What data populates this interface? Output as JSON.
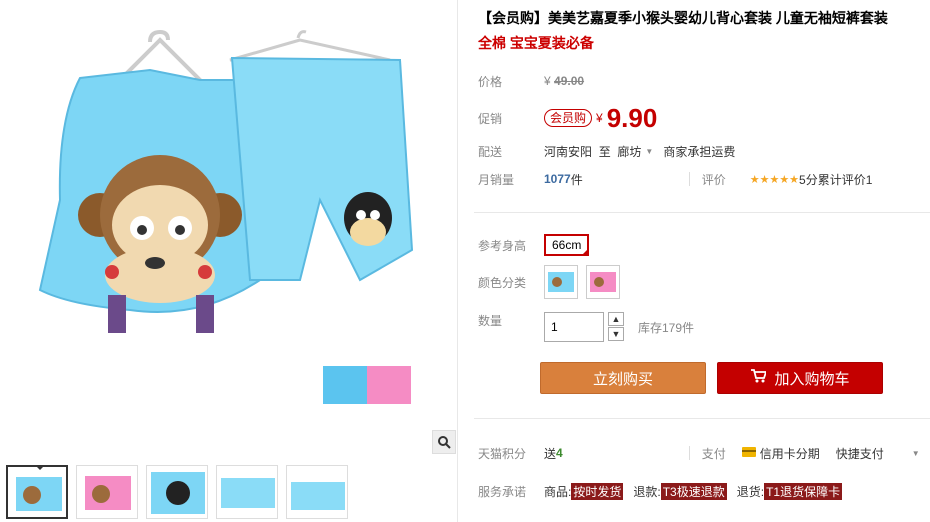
{
  "title": "【会员购】美美艺嘉夏季小猴头婴幼儿背心套装 儿童无袖短裤套装",
  "subtitle": "全棉 宝宝夏装必备",
  "price": {
    "label": "价格",
    "currency": "¥",
    "original": "49.00"
  },
  "promo": {
    "label": "促销",
    "badge": "会员购",
    "currency": "¥",
    "value": "9.90"
  },
  "shipping": {
    "label": "配送",
    "from": "河南安阳",
    "to_word": "至",
    "to": "廊坊",
    "note": "商家承担运费"
  },
  "sales": {
    "label": "月销量",
    "count": "1077",
    "unit": "件",
    "review_label": "评价",
    "stars": "★★★★★",
    "rating": "5分",
    "review_text": "累计评价1"
  },
  "size": {
    "label": "参考身高",
    "value": "66cm"
  },
  "color": {
    "label": "颜色分类"
  },
  "quantity": {
    "label": "数量",
    "value": "1",
    "up": "▲",
    "down": "▼",
    "stock": "库存179件"
  },
  "buttons": {
    "buy": "立刻购买",
    "cart": "加入购物车"
  },
  "points": {
    "label": "天猫积分",
    "send": "送",
    "value": "4",
    "pay_label": "支付",
    "credit": "信用卡分期",
    "quick": "快捷支付"
  },
  "service": {
    "label": "服务承诺",
    "goods": "商品:",
    "goods_tag": "按时发货",
    "refund": "退款:",
    "refund_tag": "T3极速退款",
    "return": "退货:",
    "return_tag": "T1退货保障卡"
  },
  "icons": [
    "zoom-icon",
    "cart-icon",
    "card-icon",
    "dropdown-icon"
  ],
  "colors": {
    "accent": "#c40000",
    "buy": "#d9803c",
    "sky": "#6fcdf0",
    "pink": "#f58cc4"
  }
}
